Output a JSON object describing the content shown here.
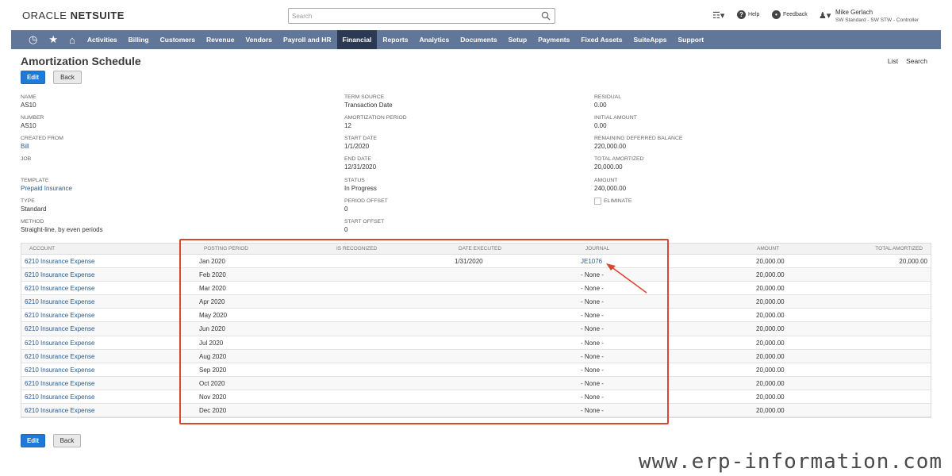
{
  "header": {
    "logo_regular": "ORACLE ",
    "logo_bold": "NETSUITE",
    "search_placeholder": "Search",
    "help_label": "Help",
    "feedback_label": "Feedback",
    "user_name": "Mike Gerlach",
    "user_role": "SW Standard - SW STW - Controller"
  },
  "nav": {
    "items": [
      "Activities",
      "Billing",
      "Customers",
      "Revenue",
      "Vendors",
      "Payroll and HR",
      "Financial",
      "Reports",
      "Analytics",
      "Documents",
      "Setup",
      "Payments",
      "Fixed Assets",
      "SuiteApps",
      "Support"
    ],
    "active": "Financial"
  },
  "page": {
    "title": "Amortization Schedule",
    "list_link": "List",
    "search_link": "Search",
    "edit_label": "Edit",
    "back_label": "Back"
  },
  "fields": {
    "name_label": "NAME",
    "name_value": "AS10",
    "number_label": "NUMBER",
    "number_value": "AS10",
    "created_from_label": "CREATED FROM",
    "created_from_value": "Bill",
    "job_label": "JOB",
    "template_label": "TEMPLATE",
    "template_value": "Prepaid Insurance",
    "type_label": "TYPE",
    "type_value": "Standard",
    "method_label": "METHOD",
    "method_value": "Straight-line, by even periods",
    "term_source_label": "TERM SOURCE",
    "term_source_value": "Transaction Date",
    "amort_period_label": "AMORTIZATION PERIOD",
    "amort_period_value": "12",
    "start_date_label": "START DATE",
    "start_date_value": "1/1/2020",
    "end_date_label": "END DATE",
    "end_date_value": "12/31/2020",
    "status_label": "STATUS",
    "status_value": "In Progress",
    "period_offset_label": "PERIOD OFFSET",
    "period_offset_value": "0",
    "start_offset_label": "START OFFSET",
    "start_offset_value": "0",
    "residual_label": "RESIDUAL",
    "residual_value": "0.00",
    "initial_amount_label": "INITIAL AMOUNT",
    "initial_amount_value": "0.00",
    "remaining_label": "REMAINING DEFERRED BALANCE",
    "remaining_value": "220,000.00",
    "total_amortized_label": "TOTAL AMORTIZED",
    "total_amortized_value": "20,000.00",
    "amount_label": "AMOUNT",
    "amount_value": "240,000.00",
    "eliminate_label": "ELIMINATE"
  },
  "table": {
    "headers": {
      "account": "ACCOUNT",
      "posting_period": "POSTING PERIOD",
      "is_recognized": "IS RECOGNIZED",
      "date_executed": "DATE EXECUTED",
      "journal": "JOURNAL",
      "amount": "AMOUNT",
      "total_amortized": "TOTAL AMORTIZED"
    },
    "rows": [
      {
        "account": "6210 Insurance Expense",
        "period": "Jan 2020",
        "date": "1/31/2020",
        "journal": "JE1076",
        "amount": "20,000.00",
        "total": "20,000.00"
      },
      {
        "account": "6210 Insurance Expense",
        "period": "Feb 2020",
        "date": "",
        "journal": "- None -",
        "amount": "20,000.00",
        "total": ""
      },
      {
        "account": "6210 Insurance Expense",
        "period": "Mar 2020",
        "date": "",
        "journal": "- None -",
        "amount": "20,000.00",
        "total": ""
      },
      {
        "account": "6210 Insurance Expense",
        "period": "Apr 2020",
        "date": "",
        "journal": "- None -",
        "amount": "20,000.00",
        "total": ""
      },
      {
        "account": "6210 Insurance Expense",
        "period": "May 2020",
        "date": "",
        "journal": "- None -",
        "amount": "20,000.00",
        "total": ""
      },
      {
        "account": "6210 Insurance Expense",
        "period": "Jun 2020",
        "date": "",
        "journal": "- None -",
        "amount": "20,000.00",
        "total": ""
      },
      {
        "account": "6210 Insurance Expense",
        "period": "Jul 2020",
        "date": "",
        "journal": "- None -",
        "amount": "20,000.00",
        "total": ""
      },
      {
        "account": "6210 Insurance Expense",
        "period": "Aug 2020",
        "date": "",
        "journal": "- None -",
        "amount": "20,000.00",
        "total": ""
      },
      {
        "account": "6210 Insurance Expense",
        "period": "Sep 2020",
        "date": "",
        "journal": "- None -",
        "amount": "20,000.00",
        "total": ""
      },
      {
        "account": "6210 Insurance Expense",
        "period": "Oct 2020",
        "date": "",
        "journal": "- None -",
        "amount": "20,000.00",
        "total": ""
      },
      {
        "account": "6210 Insurance Expense",
        "period": "Nov 2020",
        "date": "",
        "journal": "- None -",
        "amount": "20,000.00",
        "total": ""
      },
      {
        "account": "6210 Insurance Expense",
        "period": "Dec 2020",
        "date": "",
        "journal": "- None -",
        "amount": "20,000.00",
        "total": ""
      }
    ]
  },
  "watermark": "www.erp-information.com",
  "colors": {
    "nav_bg": "#607799",
    "nav_active": "#2b3a52",
    "primary_button": "#1f79d6",
    "highlight_box": "#d8472e",
    "link": "#2a5a8a"
  },
  "icons": [
    "search-icon",
    "history-icon",
    "star-icon",
    "home-icon",
    "help-icon",
    "feedback-icon",
    "user-icon",
    "arrow-annotation"
  ]
}
